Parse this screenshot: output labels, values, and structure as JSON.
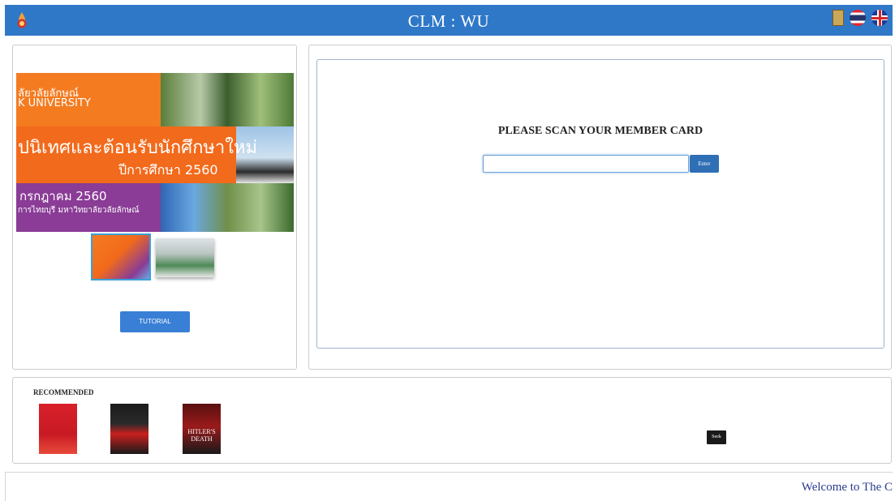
{
  "header": {
    "title": "CLM : WU",
    "colors": {
      "bar": "#2f78c8",
      "text": "#ffffff"
    }
  },
  "icons": {
    "logo": "university-logo-icon",
    "book": "book-icon",
    "thai_flag": "thai-flag-icon",
    "uk_flag": "uk-flag-icon"
  },
  "slideshow": {
    "lines": [
      "ลัยวลัยลักษณ์",
      "K UNIVERSITY",
      "ปนิเทศและต้อนรับนักศึกษาใหม่",
      "ปีการศึกษา 2560",
      "กรกฎาคม 2560",
      "การไทยบุรี มหาวิทยาลัยวลัยลักษณ์"
    ],
    "active_slide": 1,
    "slide_count": 2
  },
  "tutorial": {
    "label": "TUTORIAL"
  },
  "scan": {
    "title": "PLEASE SCAN YOUR MEMBER CARD",
    "value": "",
    "enter_label": "Enter"
  },
  "recommended": {
    "title": "RECOMMENDED",
    "books": [
      {
        "label": ""
      },
      {
        "label": ""
      },
      {
        "label": "HITLER'S DEATH"
      }
    ],
    "seek_label": "Seek"
  },
  "footer": {
    "marquee": "Welcome to The C"
  }
}
